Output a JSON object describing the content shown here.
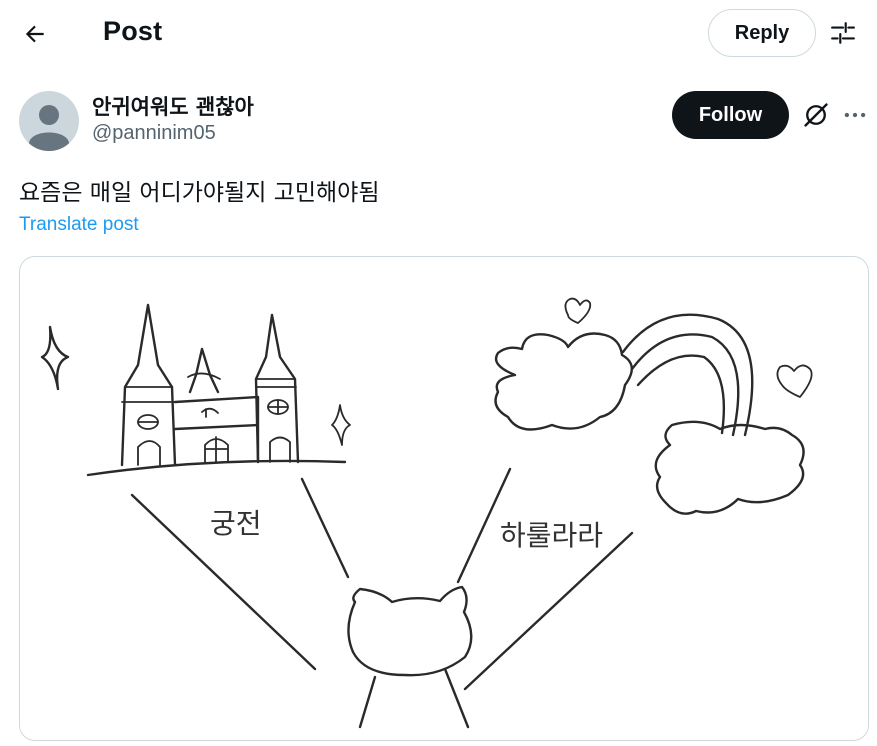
{
  "header": {
    "title": "Post",
    "reply_label": "Reply"
  },
  "post": {
    "author": {
      "display_name": "안귀여워도 괜찮아",
      "handle": "@panninim05"
    },
    "follow_label": "Follow",
    "text": "요즘은 매일 어디가야될지 고민해야됨",
    "translate_label": "Translate post",
    "image": {
      "label_left": "궁전",
      "label_right": "하룰라라"
    }
  },
  "icons": {
    "back": "back-arrow-icon",
    "filter": "sliders-icon",
    "grok": "grok-icon",
    "more": "more-dots-icon",
    "avatar": "default-avatar-icon"
  },
  "colors": {
    "follow_bg": "#0f1419",
    "link": "#1d9bf0",
    "secondary_text": "#536471",
    "border": "#cfd9de"
  }
}
